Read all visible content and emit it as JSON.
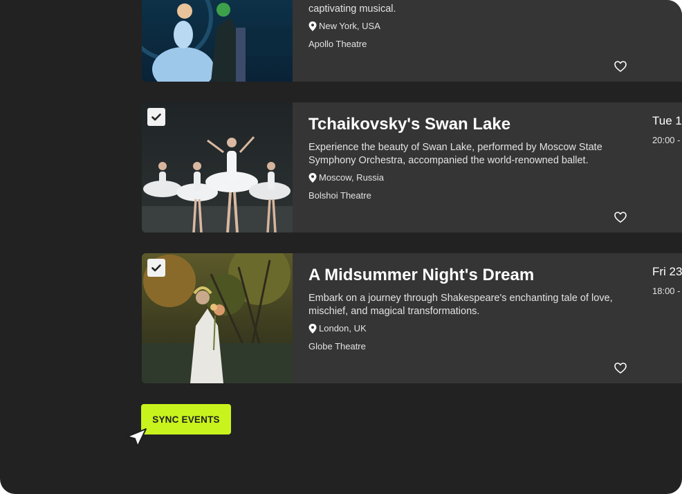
{
  "colors": {
    "background": "#222222",
    "card": "#353535",
    "accent": "#c8f31d"
  },
  "events": [
    {
      "title": "",
      "description": "captivating musical.",
      "location": "New York, USA",
      "venue": "Apollo Theatre",
      "date": "",
      "time": "",
      "checked": false,
      "favorite": false
    },
    {
      "title": "Tchaikovsky's Swan Lake",
      "description": "Experience the beauty of Swan Lake, performed by Moscow State Symphony Orchestra, accompanied the world-renowned ballet.",
      "location": "Moscow, Russia",
      "venue": "Bolshoi Theatre",
      "date": "Tue 1",
      "time": "20:00 -",
      "checked": true,
      "favorite": false
    },
    {
      "title": "A Midsummer Night's Dream",
      "description": "Embark on a journey through Shakespeare's enchanting tale of love, mischief, and magical transformations.",
      "location": "London, UK",
      "venue": "Globe Theatre",
      "date": "Fri 23",
      "time": "18:00 -",
      "checked": true,
      "favorite": false
    }
  ],
  "actions": {
    "sync_label": "SYNC EVENTS"
  },
  "icons": {
    "check": "check-icon",
    "location": "map-pin-icon",
    "favorite": "heart-icon",
    "cursor": "pointer-cursor-icon"
  }
}
